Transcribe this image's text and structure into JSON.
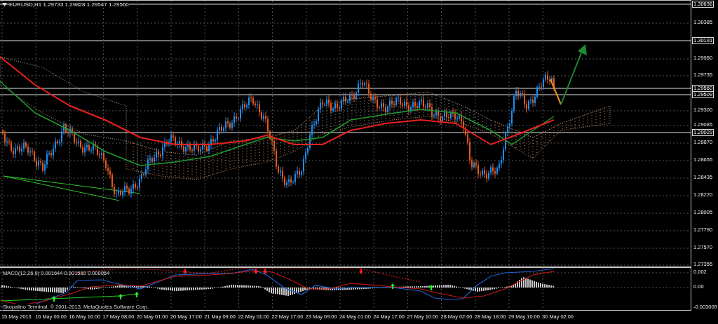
{
  "chart_title": {
    "text": "EURUSD,H1  1.29733 1.29828 1.29547 1.29560"
  },
  "price_axis": [
    {
      "label": "1.30636",
      "kind": "level"
    },
    {
      "label": "1.30385",
      "kind": "tick"
    },
    {
      "label": "1.30191",
      "kind": "level"
    },
    {
      "label": "1.29950",
      "kind": "tick"
    },
    {
      "label": "1.29735",
      "kind": "tick"
    },
    {
      "label": "1.29560",
      "kind": "level"
    },
    {
      "label": "1.29509",
      "kind": "level"
    },
    {
      "label": "1.29300",
      "kind": "tick"
    },
    {
      "label": "1.29085",
      "kind": "tick"
    },
    {
      "label": "1.29029",
      "kind": "level"
    },
    {
      "label": "1.28870",
      "kind": "tick"
    },
    {
      "label": "1.28655",
      "kind": "tick"
    },
    {
      "label": "1.28435",
      "kind": "tick"
    },
    {
      "label": "1.28220",
      "kind": "tick"
    },
    {
      "label": "1.28005",
      "kind": "tick"
    },
    {
      "label": "1.27790",
      "kind": "tick"
    },
    {
      "label": "1.27570",
      "kind": "tick"
    },
    {
      "label": "1.27355",
      "kind": "tick"
    }
  ],
  "macd": {
    "title": "MACD(12,26,9) 0.001644 0.001580 0.000064",
    "axis": [
      "0.002",
      "0.00",
      "-0.003009"
    ],
    "copyright": "Skopalino Terminal, © 2001-2013, MetaQuotes Software Corp."
  },
  "time_axis": [
    "15 May 2013",
    "16 May 00:00",
    "16 May 16:00",
    "17 May 08:00",
    "20 May 01:00",
    "20 May 17:00",
    "21 May 09:00",
    "22 May 01:00",
    "22 May 17:00",
    "23 May 09:00",
    "24 May 01:00",
    "24 May 17:00",
    "27 May 10:00",
    "28 May 02:00",
    "28 May 18:00",
    "29 May 10:00",
    "30 May 02:00"
  ]
}
